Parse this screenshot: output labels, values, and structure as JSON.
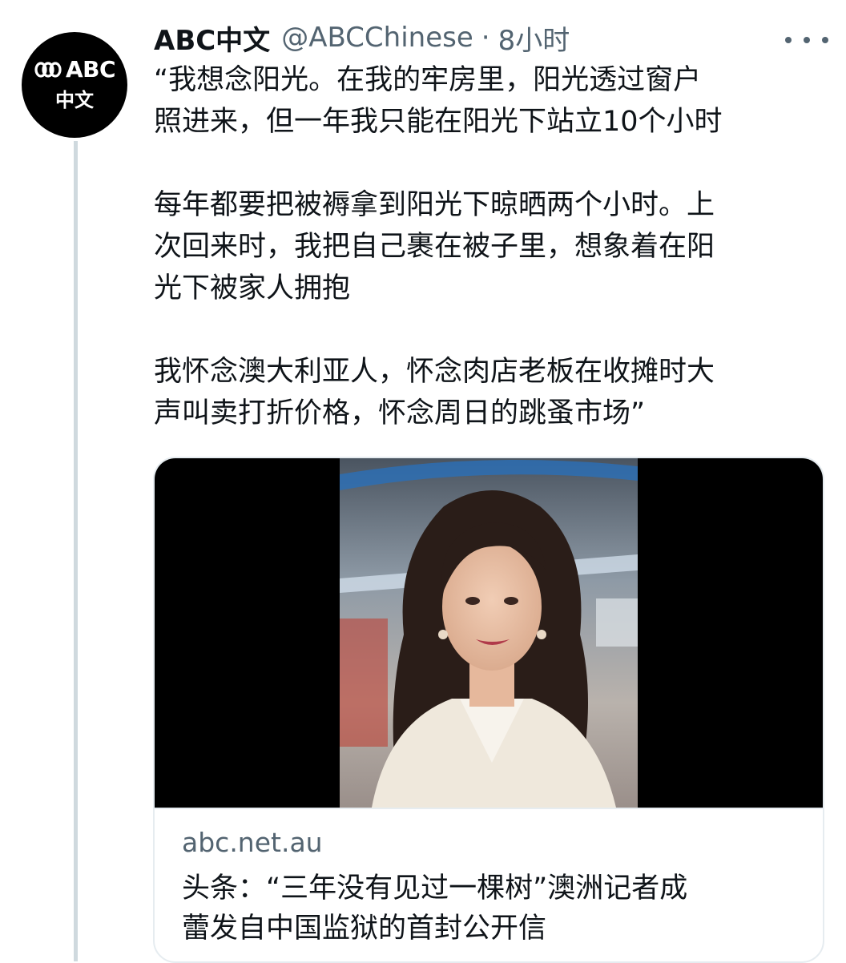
{
  "tweet": {
    "avatar": {
      "logo_text": "ABC",
      "sub_text": "中文"
    },
    "display_name": "ABC中文",
    "handle": "@ABCChinese",
    "separator": "·",
    "timestamp": "8小时",
    "more_icon": "more-horizontal-icon",
    "text_lines": [
      "“我想念阳光。在我的牢房里，阳光透过窗户",
      "照进来，但一年我只能在阳光下站立10个小时",
      "",
      "每年都要把被褥拿到阳光下晾晒两个小时。上",
      "次回来时，我把自己裹在被子里，想象着在阳",
      "光下被家人拥抱",
      "",
      "我怀念澳大利亚人，怀念肉店老板在收摊时大",
      "声叫卖打折价格，怀念周日的跳蚤市场”"
    ]
  },
  "card": {
    "domain": "abc.net.au",
    "title_lines": [
      "头条：“三年没有见过一棵树”澳洲记者成",
      "蕾发自中国监狱的首封公开信"
    ]
  },
  "colors": {
    "primary_text": "#0f1419",
    "secondary_text": "#536471",
    "border": "#e6ecf0",
    "thread_line": "#cfd9de"
  }
}
